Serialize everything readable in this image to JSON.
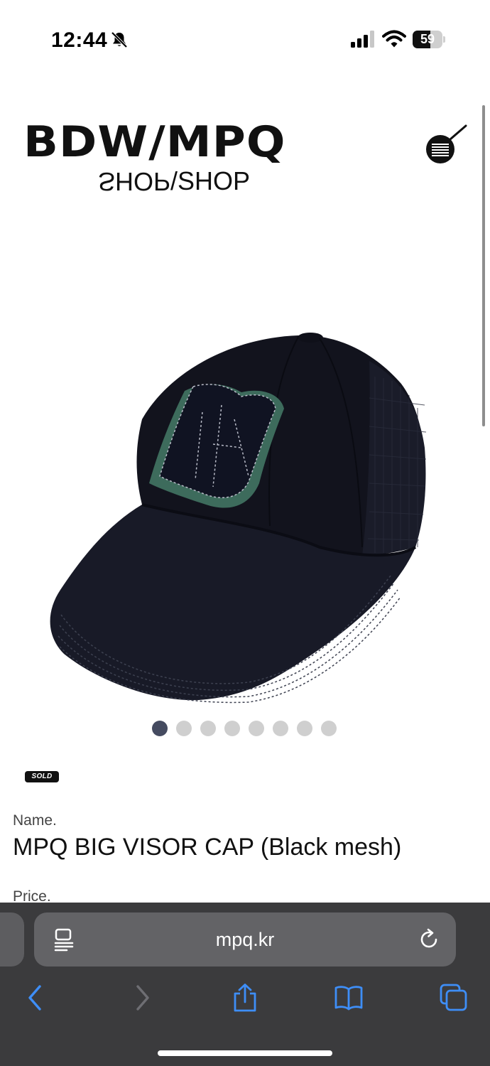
{
  "status_bar": {
    "time": "12:44",
    "battery": "59",
    "battery_level": 0.59,
    "icons": [
      "bell-slash-icon",
      "cellular-signal-icon",
      "wifi-icon",
      "battery-icon"
    ]
  },
  "header": {
    "logo": "BDW/MPQ",
    "sub_flipped": "SHOP",
    "sub_tail": "/SHOP",
    "menu_icon": "hamburger-menu-icon"
  },
  "gallery": {
    "total_images": 8,
    "active_index": 0
  },
  "product": {
    "badge": "SOLD",
    "name_label": "Name.",
    "name": "MPQ BIG VISOR CAP (Black mesh)",
    "price_label": "Price."
  },
  "browser": {
    "url": "mpq.kr",
    "icons": [
      "reader-icon",
      "reload-icon",
      "back-icon",
      "forward-icon",
      "share-icon",
      "bookmarks-icon",
      "tabs-icon"
    ],
    "accent_color": "#3e8ef7",
    "disabled_color": "#6e6e73"
  }
}
